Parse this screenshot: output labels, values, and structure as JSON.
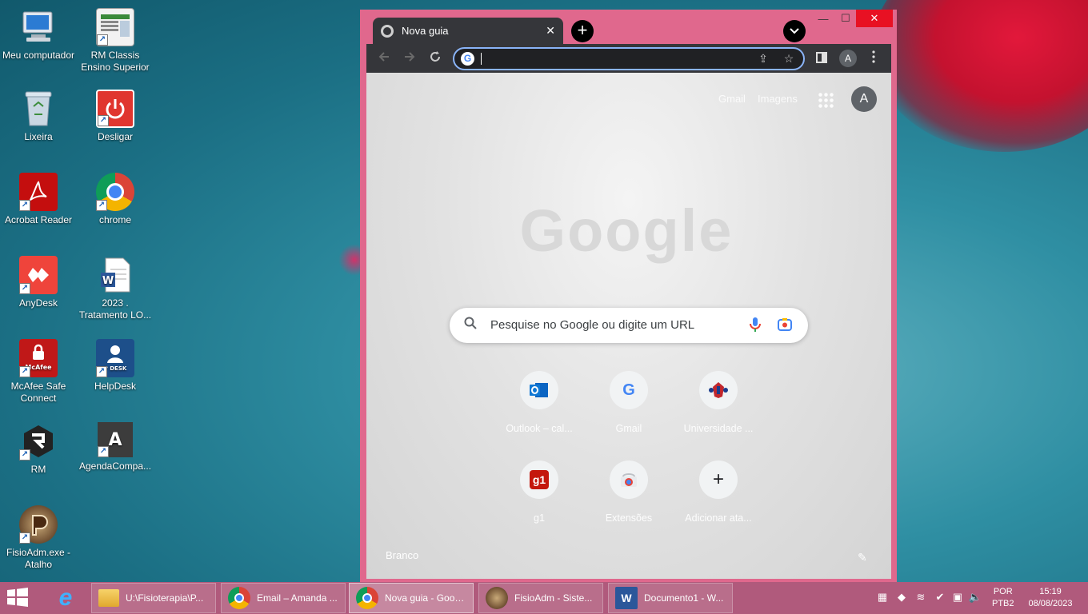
{
  "desktop": {
    "icons": [
      {
        "label": "Meu computador",
        "icon": "computer-icon"
      },
      {
        "label": "RM Classis Ensino Superior",
        "icon": "rm-classis-icon"
      },
      {
        "label": "Lixeira",
        "icon": "recycle-bin-icon"
      },
      {
        "label": "Desligar",
        "icon": "power-icon"
      },
      {
        "label": "Acrobat Reader",
        "icon": "acrobat-icon"
      },
      {
        "label": "chrome",
        "icon": "chrome-icon"
      },
      {
        "label": "AnyDesk",
        "icon": "anydesk-icon"
      },
      {
        "label": "2023 . Tratamento LO...",
        "icon": "word-document-icon"
      },
      {
        "label": "McAfee Safe Connect",
        "icon": "mcafee-icon"
      },
      {
        "label": "HelpDesk",
        "icon": "helpdesk-icon"
      },
      {
        "label": "RM",
        "icon": "rm-icon"
      },
      {
        "label": "AgendaCompa...",
        "icon": "agenda-icon"
      },
      {
        "label": "FisioAdm.exe - Atalho",
        "icon": "fisioadm-icon"
      }
    ],
    "agenda_letter": "A",
    "mcafee_text": "McAfee",
    "helpdesk_text": "P DESK"
  },
  "browser": {
    "tab_title": "Nova guia",
    "tab_close": "✕",
    "new_tab": "+",
    "profile_initial": "A",
    "omnibox_value": "",
    "window_controls": {
      "minimize": "—",
      "maximize": "☐",
      "close": "✕"
    }
  },
  "ntp": {
    "gmail_link": "Gmail",
    "images_link": "Imagens",
    "avatar_initial": "A",
    "logo_text": "Google",
    "search_placeholder": "Pesquise no Google ou digite um URL",
    "shortcuts": [
      {
        "label": "Outlook – cal...",
        "icon": "outlook-icon"
      },
      {
        "label": "Gmail",
        "icon": "google-icon"
      },
      {
        "label": "Universidade ...",
        "icon": "university-icon"
      },
      {
        "label": "g1",
        "icon": "g1-icon"
      },
      {
        "label": "Extensões",
        "icon": "chrome-web-store-icon"
      },
      {
        "label": "Adicionar ata...",
        "icon": "add-icon"
      }
    ],
    "g1_text": "g1",
    "theme_label": "Branco"
  },
  "taskbar": {
    "tasks": [
      {
        "label": "U:\\Fisioterapia\\P...",
        "icon": "folder-icon"
      },
      {
        "label": "Email – Amanda ...",
        "icon": "chrome-icon"
      },
      {
        "label": "Nova guia - Goog...",
        "icon": "chrome-icon"
      },
      {
        "label": "FisioAdm - Siste...",
        "icon": "fisioadm-icon"
      },
      {
        "label": "Documento1 - W...",
        "icon": "word-icon"
      }
    ],
    "lang_1": "POR",
    "lang_2": "PTB2",
    "time": "15:19",
    "date": "08/08/2023"
  }
}
